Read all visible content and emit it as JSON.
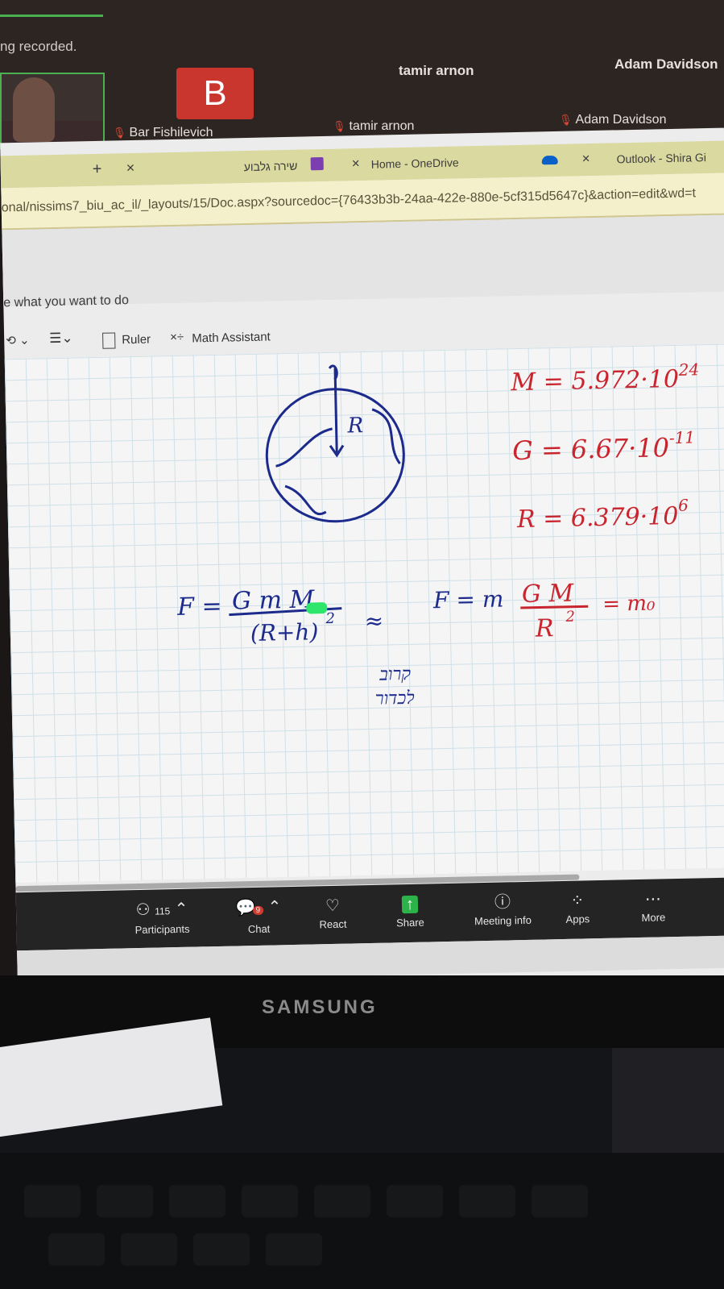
{
  "meeting": {
    "recording_text": "ng recorded.",
    "participants_top": [
      "tamir arnon",
      "Adam Davidson"
    ],
    "avatar_letter": "B",
    "tiles": [
      {
        "name": "Bar Fishilevich"
      },
      {
        "name": "tamir arnon"
      },
      {
        "name": "Adam Davidson"
      }
    ]
  },
  "browser": {
    "tabs": [
      {
        "label": "שירה גלבוע"
      },
      {
        "label": "Home - OneDrive"
      },
      {
        "label": "Outlook - Shira Gi"
      }
    ],
    "new_tab_label": "+",
    "close_label": "×",
    "url": "onal/nissims7_biu_ac_il/_layouts/15/Doc.aspx?sourcedoc={76433b3b-24aa-422e-880e-5cf315d5647c}&action=edit&wd=t",
    "tell_me": "e what you want to do",
    "toolbar": {
      "ruler": "Ruler",
      "math_assistant": "Math Assistant"
    }
  },
  "ink": {
    "constants": [
      {
        "lhs": "M",
        "mantissa": "5.972",
        "exp": "24"
      },
      {
        "lhs": "G",
        "mantissa": "6.67",
        "exp": "-11"
      },
      {
        "lhs": "R",
        "mantissa": "6.379",
        "exp": "6"
      }
    ],
    "formula_left": {
      "lhs": "F =",
      "num": "G m M",
      "den": "(R+h)",
      "pow": "2"
    },
    "approx": "≈",
    "hebrew_note": [
      "קרוב",
      "לכדור"
    ],
    "formula_right": {
      "lhs": "F = m",
      "num": "G M",
      "den": "R",
      "pow": "2",
      "rhs": "= m₀"
    },
    "earth_label": "R",
    "ink_blue": "#1c2a8c",
    "ink_red": "#c8252e"
  },
  "zoom_controls": {
    "participants_count": "115",
    "chat_badge": "9",
    "buttons": [
      "Participants",
      "Chat",
      "React",
      "Share",
      "Meeting info",
      "Apps",
      "More"
    ]
  },
  "monitor": {
    "brand": "SAMSUNG"
  }
}
